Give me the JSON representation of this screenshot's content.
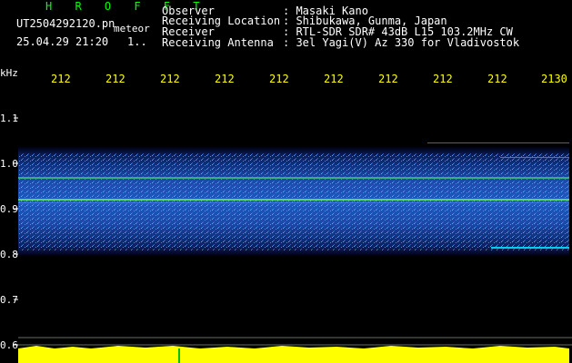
{
  "header": {
    "app_name": "H R O F F T",
    "filename": "UT2504292120.pn",
    "mode": "meteor",
    "datetime": "25.04.29 21:20",
    "count": "1..",
    "info": [
      {
        "label": "Observer",
        "value": ": Masaki Kano"
      },
      {
        "label": "Receiving Location",
        "value": ": Shibukawa, Gunma, Japan"
      },
      {
        "label": "Receiver",
        "value": ": RTL-SDR SDR# 43dB L15 103.2MHz CW"
      },
      {
        "label": "Receiving Antenna",
        "value": ": 3el Yagi(V) Az 330 for Vladivostok"
      }
    ]
  },
  "axis": {
    "unit": "kHz",
    "freq_labels": [
      "1.1",
      "1.0",
      "0.9",
      "0.8",
      "0.7",
      "0.6"
    ],
    "time_labels": [
      "212",
      "212",
      "212",
      "212",
      "212",
      "212",
      "212",
      "212",
      "212",
      "2130"
    ]
  },
  "colors": {
    "text_green": "#00ff00",
    "text_white": "#ffffff",
    "text_yellow": "#ffff00",
    "text_cyan": "#00ffff",
    "noise_band": "#1e50c8",
    "amplitude_bar": "#ffff00"
  }
}
